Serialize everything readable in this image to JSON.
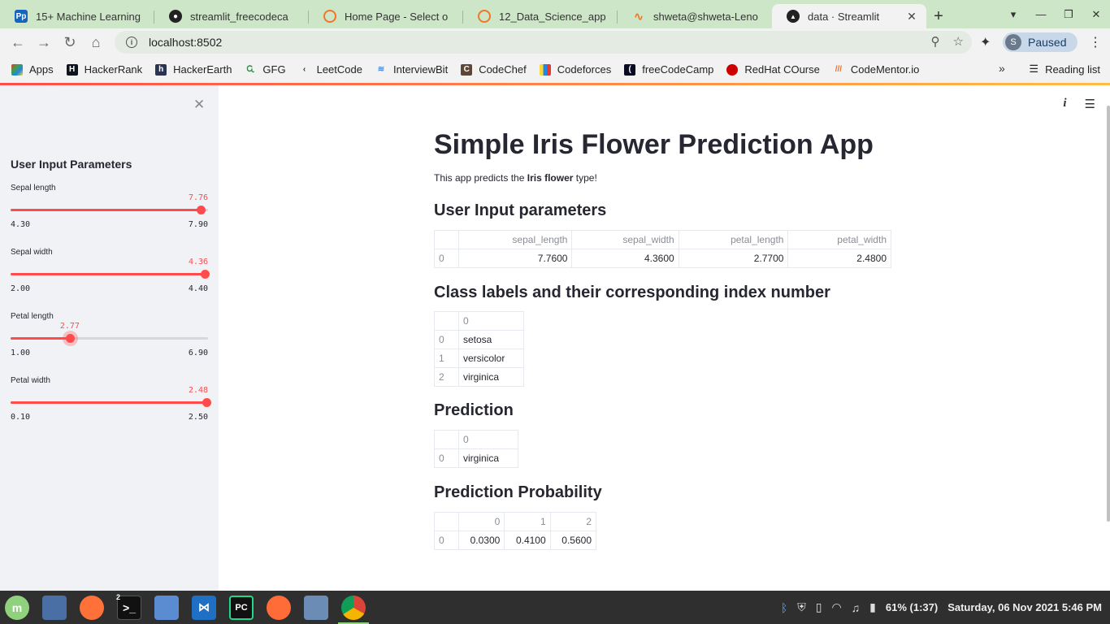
{
  "browser": {
    "tabs": [
      {
        "title": "15+ Machine Learning",
        "favicon": "Pp",
        "color": "#1565c0"
      },
      {
        "title": "streamlit_freecodeca",
        "favicon": "github-icon",
        "color": "#222222"
      },
      {
        "title": "Home Page - Select o",
        "favicon": "jupyter-icon",
        "color": "#f37626"
      },
      {
        "title": "12_Data_Science_app",
        "favicon": "jupyter-icon",
        "color": "#f37626"
      },
      {
        "title": "shweta@shweta-Leno",
        "favicon": "jupyter-icon",
        "color": "#f37626"
      },
      {
        "title": "data · Streamlit",
        "favicon": "streamlit-icon",
        "color": "#222222",
        "active": true
      }
    ],
    "new_tab": "+",
    "url": "localhost:8502",
    "profile": {
      "initial": "S",
      "status": "Paused"
    },
    "bookmarks": [
      {
        "label": "Apps",
        "color": "#e53935"
      },
      {
        "label": "HackerRank",
        "color": "#1ba94c"
      },
      {
        "label": "HackerEarth",
        "color": "#2c3454"
      },
      {
        "label": "GFG",
        "color": "#2f8d46"
      },
      {
        "label": "LeetCode",
        "color": "#ffa116"
      },
      {
        "label": "InterviewBit",
        "color": "#4a90e2"
      },
      {
        "label": "CodeChef",
        "color": "#5b4638"
      },
      {
        "label": "Codeforces",
        "color": "#1f8acb"
      },
      {
        "label": "freeCodeCamp",
        "color": "#0a0a23"
      },
      {
        "label": "RedHat COurse",
        "color": "#cc0000"
      },
      {
        "label": "CodeMentor.io",
        "color": "#f36d21"
      }
    ],
    "more": "»",
    "reading_list": "Reading list"
  },
  "sidebar": {
    "title": "User Input Parameters",
    "sliders": [
      {
        "label": "Sepal length",
        "min": 4.3,
        "max": 7.9,
        "value": 7.76,
        "min_text": "4.30",
        "max_text": "7.90",
        "value_text": "7.76"
      },
      {
        "label": "Sepal width",
        "min": 2.0,
        "max": 4.4,
        "value": 4.36,
        "min_text": "2.00",
        "max_text": "4.40",
        "value_text": "4.36"
      },
      {
        "label": "Petal length",
        "min": 1.0,
        "max": 6.9,
        "value": 2.77,
        "min_text": "1.00",
        "max_text": "6.90",
        "value_text": "2.77"
      },
      {
        "label": "Petal width",
        "min": 0.1,
        "max": 2.5,
        "value": 2.48,
        "min_text": "0.10",
        "max_text": "2.50",
        "value_text": "2.48"
      }
    ]
  },
  "main": {
    "title": "Simple Iris Flower Prediction App",
    "intro_prefix": "This app predicts the ",
    "intro_bold": "Iris flower",
    "intro_suffix": " type!",
    "input_header": "User Input parameters",
    "input_table": {
      "columns": [
        "sepal_length",
        "sepal_width",
        "petal_length",
        "petal_width"
      ],
      "rows": [
        {
          "index": "0",
          "values": [
            "7.7600",
            "4.3600",
            "2.7700",
            "2.4800"
          ]
        }
      ]
    },
    "labels_header": "Class labels and their corresponding index number",
    "labels_table": {
      "columns": [
        "0"
      ],
      "rows": [
        {
          "index": "0",
          "values": [
            "setosa"
          ]
        },
        {
          "index": "1",
          "values": [
            "versicolor"
          ]
        },
        {
          "index": "2",
          "values": [
            "virginica"
          ]
        }
      ]
    },
    "prediction_header": "Prediction",
    "prediction_table": {
      "columns": [
        "0"
      ],
      "rows": [
        {
          "index": "0",
          "values": [
            "virginica"
          ]
        }
      ]
    },
    "probability_header": "Prediction Probability",
    "probability_table": {
      "columns": [
        "0",
        "1",
        "2"
      ],
      "rows": [
        {
          "index": "0",
          "values": [
            "0.0300",
            "0.4100",
            "0.5600"
          ]
        }
      ]
    }
  },
  "taskbar": {
    "terminal_badge": "2",
    "battery": "61% (1:37)",
    "clock": "Saturday, 06 Nov 2021  5:46 PM"
  }
}
